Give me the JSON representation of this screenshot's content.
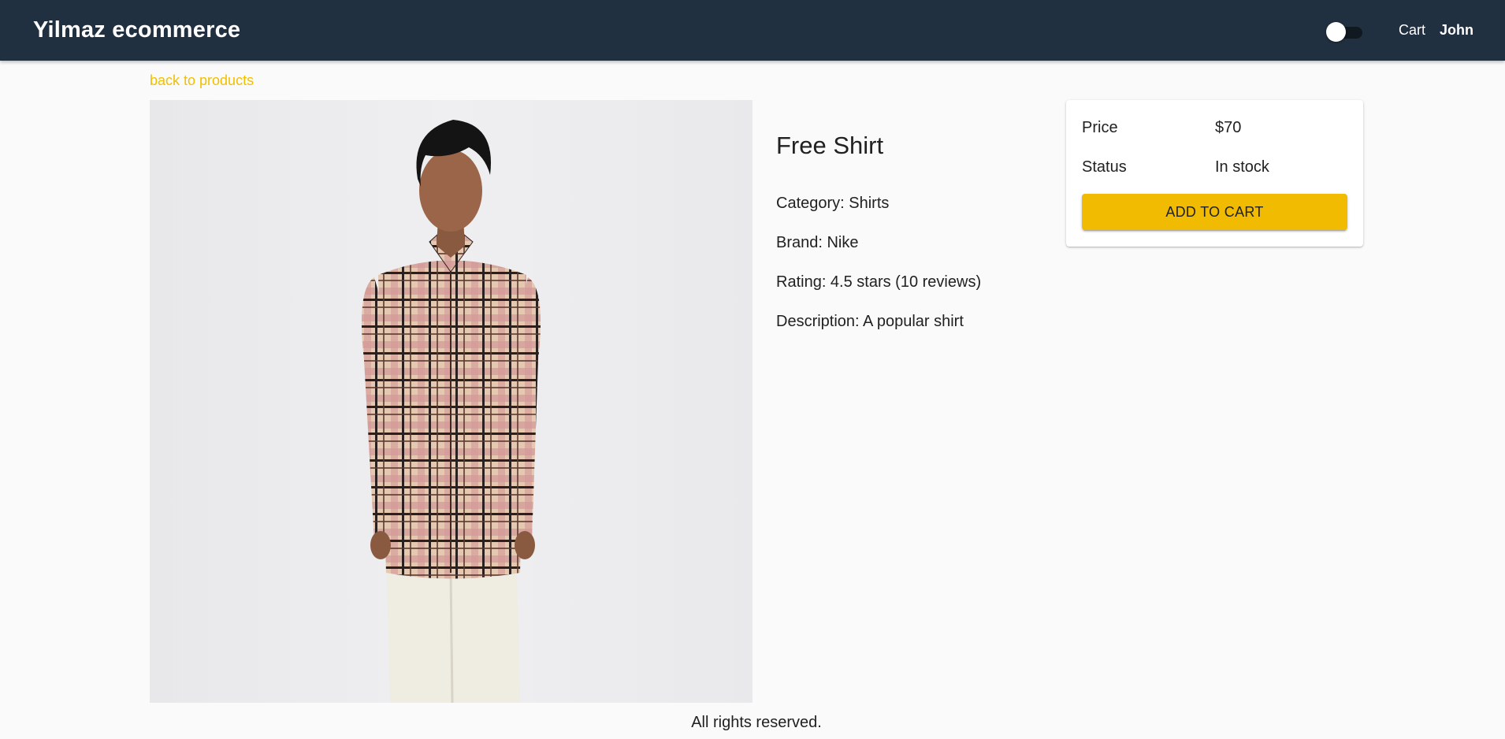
{
  "header": {
    "brand": "Yilmaz ecommerce",
    "theme_toggle_checked": false,
    "cart_label": "Cart",
    "user_name": "John"
  },
  "nav": {
    "back_label": "back to products"
  },
  "product": {
    "image_alt": "Free Shirt",
    "name": "Free Shirt",
    "category_line": "Category: Shirts",
    "brand_line": "Brand: Nike",
    "rating_line": "Rating: 4.5 stars (10 reviews)",
    "description_line": "Description: A popular shirt"
  },
  "purchase": {
    "price_label": "Price",
    "price_value": "$70",
    "status_label": "Status",
    "status_value": "In stock",
    "add_button_label": "ADD TO CART"
  },
  "footer": {
    "text": "All rights reserved."
  },
  "colors": {
    "appbar": "#203040",
    "accent": "#f0c000",
    "button": "#f0bb00",
    "background": "#fafafa"
  }
}
